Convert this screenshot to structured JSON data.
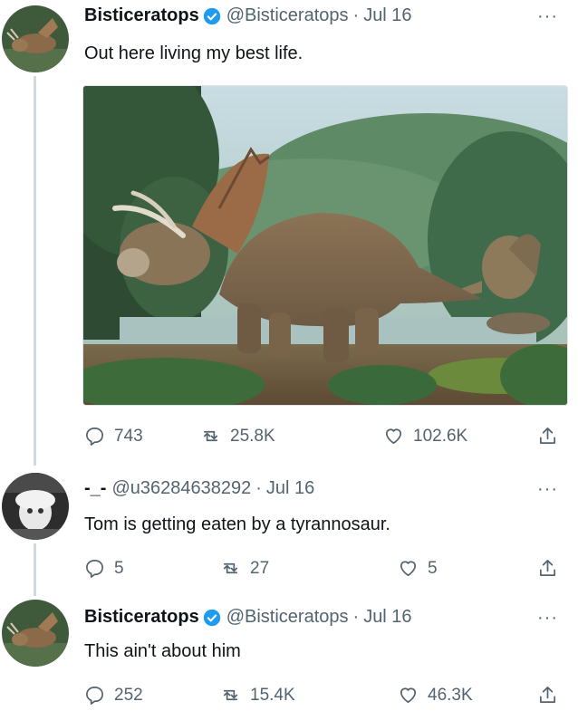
{
  "tweets": [
    {
      "name": "Bisticeratops",
      "handle": "@Bisticeratops",
      "separator": "·",
      "date": "Jul 16",
      "text": "Out here living my best life.",
      "stats": {
        "replies": "743",
        "retweets": "25.8K",
        "likes": "102.6K"
      },
      "more": "···"
    },
    {
      "name": "-_-",
      "handle": "@u36284638292",
      "separator": "·",
      "date": "Jul 16",
      "text": "Tom is getting eaten by a tyrannosaur.",
      "stats": {
        "replies": "5",
        "retweets": "27",
        "likes": "5"
      },
      "more": "···"
    },
    {
      "name": "Bisticeratops",
      "handle": "@Bisticeratops",
      "separator": "·",
      "date": "Jul 16",
      "text": "This ain't about him",
      "stats": {
        "replies": "252",
        "retweets": "15.4K",
        "likes": "46.3K"
      },
      "more": "···"
    }
  ],
  "colors": {
    "verified": "#1d9bf0",
    "secondary_text": "#536471",
    "thread_line": "#cfd9de"
  }
}
